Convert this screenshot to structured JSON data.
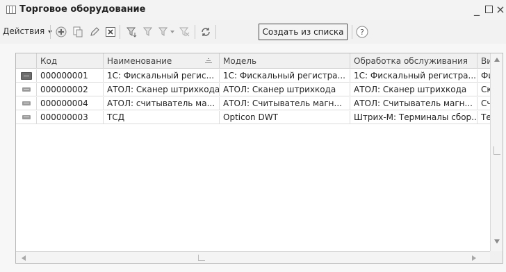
{
  "window": {
    "title": "Торговое оборудование",
    "min_glyph": "_",
    "close_glyph": "×"
  },
  "toolbar": {
    "actions_label": "Действия",
    "create_from_list_label": "Создать из списка",
    "icons": [
      "add-icon",
      "copy-icon",
      "edit-icon",
      "delete-icon",
      "filter-icon",
      "filter-by-value-icon",
      "filter-history-icon",
      "clear-filter-icon",
      "refresh-icon",
      "help-icon"
    ]
  },
  "table": {
    "columns": [
      "",
      "Код",
      "Наименование",
      "Модель",
      "Обработка обслуживания",
      "Ви"
    ],
    "rows": [
      {
        "code": "000000001",
        "name": "1С: Фискальный регис...",
        "model": "1С: Фискальный регистра...",
        "handler": "1С: Фискальный регистра...",
        "kind": "Фи",
        "selected": true
      },
      {
        "code": "000000002",
        "name": "АТОЛ: Сканер штрихкода",
        "model": "АТОЛ: Сканер штрихкода",
        "handler": "АТОЛ: Сканер штрихкода",
        "kind": "Ск",
        "selected": false
      },
      {
        "code": "000000004",
        "name": "АТОЛ: считыватель ма...",
        "model": "АТОЛ: Считыватель магн...",
        "handler": "АТОЛ: Считыватель магн...",
        "kind": "Сч",
        "selected": false
      },
      {
        "code": "000000003",
        "name": "ТСД",
        "model": "Opticon DWT",
        "handler": "Штрих-М: Терминалы сбор...",
        "kind": "Те",
        "selected": false
      }
    ]
  },
  "colors": {
    "titlebar": "#f3f3f3",
    "grid_header": "#f0f0f0",
    "grid_border": "#b9b9b9"
  }
}
